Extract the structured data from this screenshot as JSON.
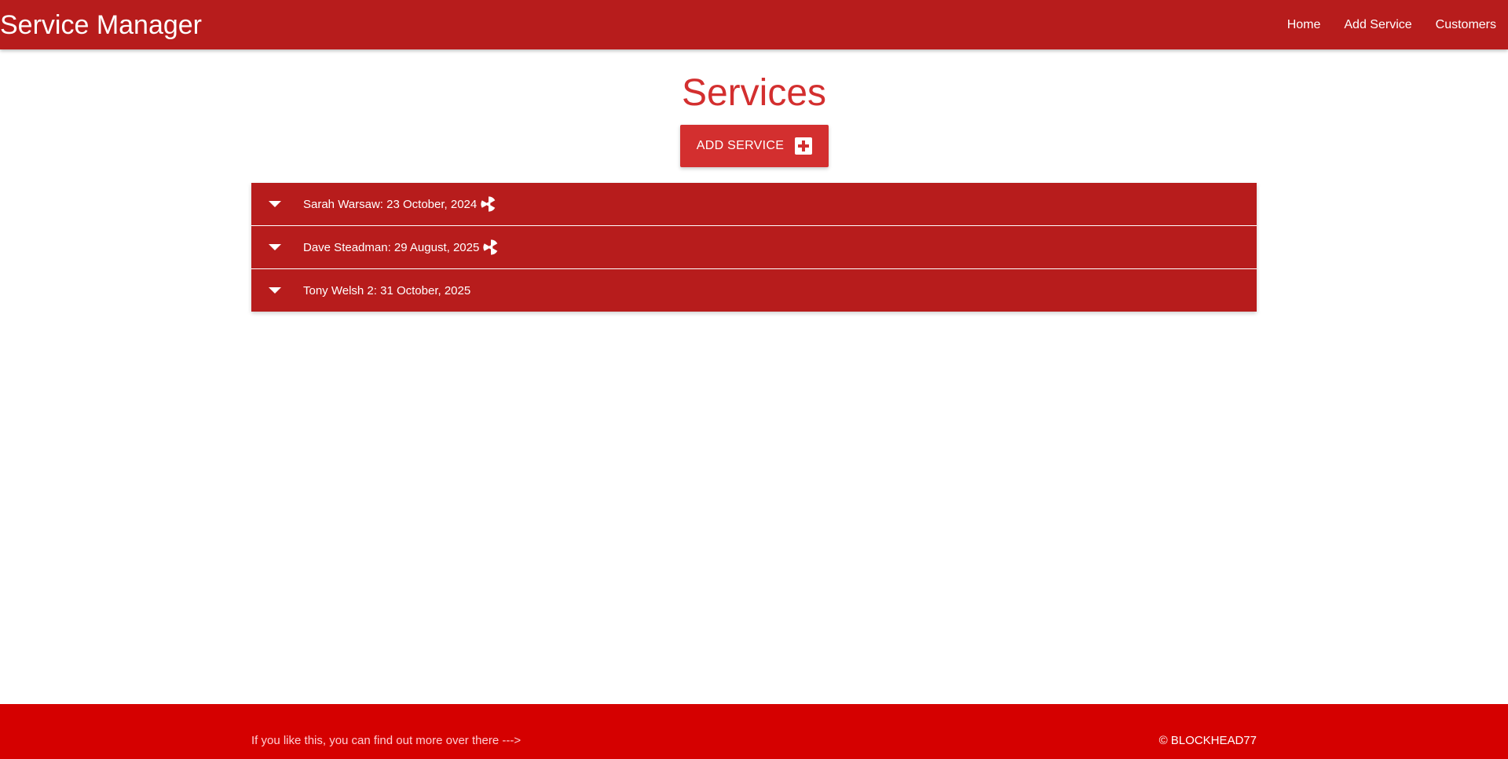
{
  "app": {
    "title": "Service Manager"
  },
  "nav": {
    "items": [
      {
        "label": "Home"
      },
      {
        "label": "Add Service"
      },
      {
        "label": "Customers"
      }
    ]
  },
  "main": {
    "title": "Services",
    "add_button_label": "ADD SERVICE",
    "add_button_icon": "plus-box-icon"
  },
  "services": [
    {
      "label": "Sarah Warsaw: 23 October, 2024",
      "icon": "radiation-icon"
    },
    {
      "label": "Dave Steadman: 29 August, 2025",
      "icon": "radiation-icon"
    },
    {
      "label": "Tony Welsh 2: 31 October, 2025",
      "icon": ""
    }
  ],
  "footer": {
    "left_text": "If you like this, you can find out more over there --->",
    "right_text": "© BLOCKHEAD77"
  },
  "colors": {
    "navbar": "#b71c1c",
    "accent": "#d32f2f",
    "footer": "#d50000"
  }
}
